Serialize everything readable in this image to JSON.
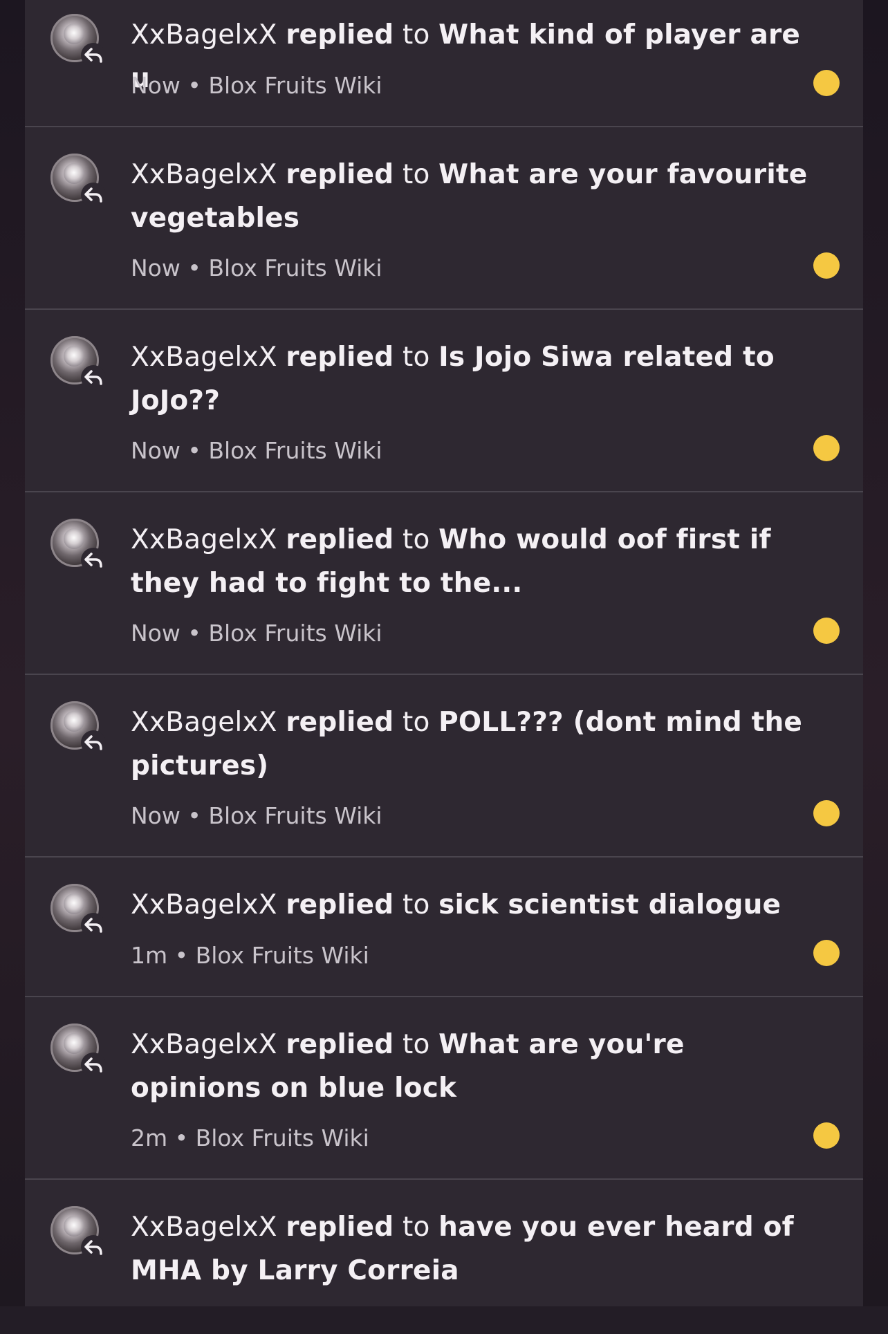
{
  "colors": {
    "background": "#2e2831",
    "divider": "#4a454e",
    "text": "#f4f0f4",
    "meta_text": "#c9c4cb",
    "unread_dot": "#f5c842"
  },
  "notifications": [
    {
      "user": "XxBagelxX",
      "action": "replied",
      "connector": "to",
      "title": "What kind of player are u",
      "time": "Now",
      "source": "Blox Fruits Wiki",
      "icon": "reply-arrow-icon",
      "unread": true
    },
    {
      "user": "XxBagelxX",
      "action": "replied",
      "connector": "to",
      "title": "What are your favourite vegetables",
      "time": "Now",
      "source": "Blox Fruits Wiki",
      "icon": "reply-arrow-icon",
      "unread": true
    },
    {
      "user": "XxBagelxX",
      "action": "replied",
      "connector": "to",
      "title": "Is Jojo Siwa related to JoJo??",
      "time": "Now",
      "source": "Blox Fruits Wiki",
      "icon": "reply-arrow-icon",
      "unread": true
    },
    {
      "user": "XxBagelxX",
      "action": "replied",
      "connector": "to",
      "title": "Who would oof first if they had to fight to the...",
      "time": "Now",
      "source": "Blox Fruits Wiki",
      "icon": "reply-arrow-icon",
      "unread": true
    },
    {
      "user": "XxBagelxX",
      "action": "replied",
      "connector": "to",
      "title": "POLL??? (dont mind the pictures)",
      "time": "Now",
      "source": "Blox Fruits Wiki",
      "icon": "reply-arrow-icon",
      "unread": true
    },
    {
      "user": "XxBagelxX",
      "action": "replied",
      "connector": "to",
      "title": "sick scientist dialogue",
      "time": "1m",
      "source": "Blox Fruits Wiki",
      "icon": "reply-arrow-icon",
      "unread": true
    },
    {
      "user": "XxBagelxX",
      "action": "replied",
      "connector": "to",
      "title": "What are you're opinions on blue lock",
      "time": "2m",
      "source": "Blox Fruits Wiki",
      "icon": "reply-arrow-icon",
      "unread": true
    },
    {
      "user": "XxBagelxX",
      "action": "replied",
      "connector": "to",
      "title": "have you ever heard of MHA by Larry Correia",
      "time": "",
      "source": "",
      "icon": "reply-arrow-icon",
      "unread": false
    }
  ],
  "separator": "•"
}
